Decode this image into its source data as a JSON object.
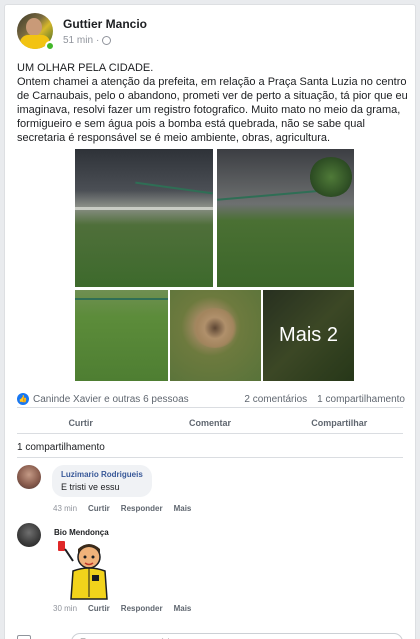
{
  "post": {
    "author": "Guttier Mancio",
    "time": "51 min",
    "text_lines": [
      "UM OLHAR PELA CIDADE.",
      "Ontem chamei a atenção da prefeita, em relação a Praça Santa Luzia no centro de Carnaubais, pelo o abandono, prometi ver de perto a situação, tá pior que eu imaginava, resolvi fazer um registro fotografico. Muito mato no meio da grama, formigueiro e sem água pois a bomba está quebrada, não se sabe qual secretaria é responsável se é meio ambiente, obras, agricultura."
    ],
    "more_photos_label": "Mais 2"
  },
  "stats": {
    "reactors": "Caninde Xavier e outras 6 pessoas",
    "comments": "2 comentários",
    "shares": "1 compartilhamento"
  },
  "actions": {
    "like": "Curtir",
    "comment": "Comentar",
    "share": "Compartilhar"
  },
  "shares_line": "1 compartilhamento",
  "comments": [
    {
      "name": "Luzimario Rodrigueis",
      "text": "E tristi ve essu",
      "time": "43 min",
      "like": "Curtir",
      "reply": "Responder",
      "more": "Mais"
    },
    {
      "name": "Bio Mendonça",
      "time": "30 min",
      "like": "Curtir",
      "reply": "Responder",
      "more": "Mais"
    }
  ],
  "composer": {
    "placeholder": "Escreva um comentário..."
  },
  "colors": {
    "link": "#385898",
    "like_badge": "#1877f2",
    "online": "#42b72a"
  }
}
